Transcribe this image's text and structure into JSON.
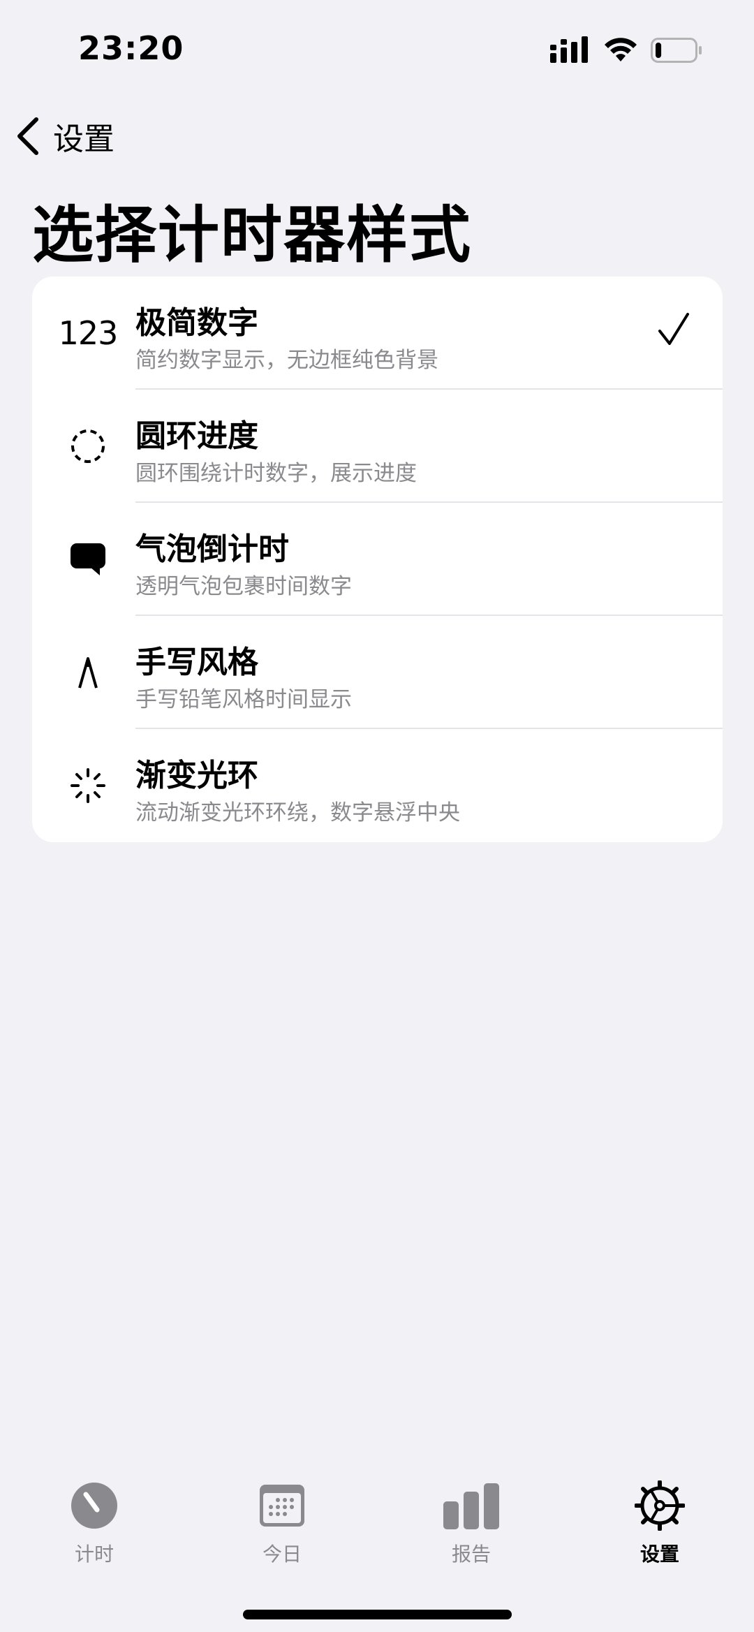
{
  "status_bar": {
    "time": "23:20",
    "battery_level": 0.15
  },
  "nav": {
    "back_label": "设置"
  },
  "page": {
    "title": "选择计时器样式"
  },
  "styles": [
    {
      "icon": "123",
      "icon_name": "number-icon",
      "title": "极简数字",
      "subtitle": "简约数字显示，无边框纯色背景",
      "selected": true
    },
    {
      "icon_name": "dashed-circle-icon",
      "title": "圆环进度",
      "subtitle": "圆环围绕计时数字，展示进度",
      "selected": false
    },
    {
      "icon_name": "speech-bubble-icon",
      "title": "气泡倒计时",
      "subtitle": "透明气泡包裹时间数字",
      "selected": false
    },
    {
      "icon_name": "pencil-tip-icon",
      "title": "手写风格",
      "subtitle": "手写铅笔风格时间显示",
      "selected": false
    },
    {
      "icon_name": "spinner-icon",
      "title": "渐变光环",
      "subtitle": "流动渐变光环环绕，数字悬浮中央",
      "selected": false
    }
  ],
  "tabs": [
    {
      "label": "计时",
      "icon_name": "timer-icon",
      "active": false
    },
    {
      "label": "今日",
      "icon_name": "calendar-icon",
      "active": false
    },
    {
      "label": "报告",
      "icon_name": "bar-chart-icon",
      "active": false
    },
    {
      "label": "设置",
      "icon_name": "gear-icon",
      "active": true
    }
  ],
  "colors": {
    "background": "#f1f1f6",
    "inactive_tab": "#8a8a8e",
    "active_tab": "#000000"
  }
}
